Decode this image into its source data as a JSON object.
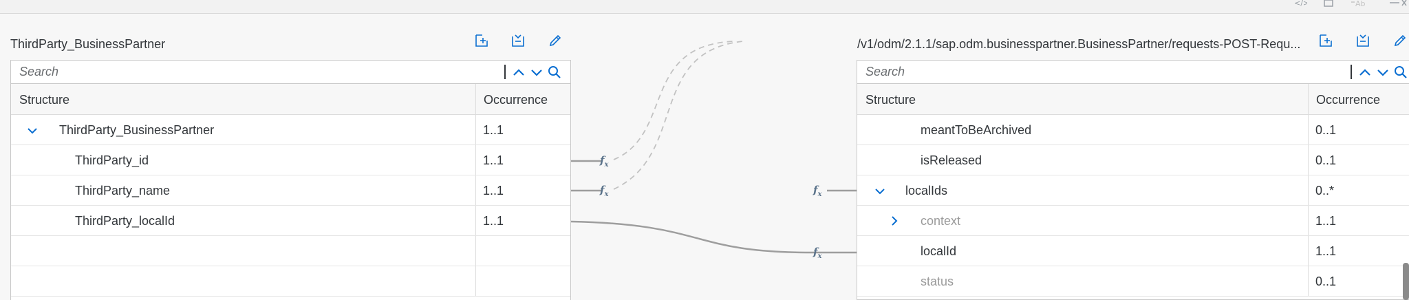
{
  "left": {
    "title": "ThirdParty_BusinessPartner",
    "search_placeholder": "Search",
    "col_structure": "Structure",
    "col_occurrence": "Occurrence",
    "rows": [
      {
        "name": "ThirdParty_BusinessPartner",
        "occ": "1..1"
      },
      {
        "name": "ThirdParty_id",
        "occ": "1..1"
      },
      {
        "name": "ThirdParty_name",
        "occ": "1..1"
      },
      {
        "name": "ThirdParty_localId",
        "occ": "1..1"
      }
    ]
  },
  "right": {
    "title": "/v1/odm/2.1.1/sap.odm.businesspartner.BusinessPartner/requests-POST-Requ...",
    "search_placeholder": "Search",
    "col_structure": "Structure",
    "col_occurrence": "Occurrence",
    "rows": [
      {
        "name": "meantToBeArchived",
        "occ": "0..1"
      },
      {
        "name": "isReleased",
        "occ": "0..1"
      },
      {
        "name": "localIds",
        "occ": "0..*"
      },
      {
        "name": "context",
        "occ": "1..1"
      },
      {
        "name": "localId",
        "occ": "1..1"
      },
      {
        "name": "status",
        "occ": "0..1"
      }
    ]
  },
  "icons": {
    "add_node": "add-node-icon",
    "collapse_all": "collapse-all-icon",
    "edit": "pencil-icon",
    "search": "search-icon",
    "prev": "chevron-up-icon",
    "next": "chevron-down-icon",
    "function": "fx-function-icon"
  },
  "colors": {
    "accent": "#0a6ed1",
    "connector": "#9e9e9e",
    "muted_text": "#9b9b9b"
  }
}
